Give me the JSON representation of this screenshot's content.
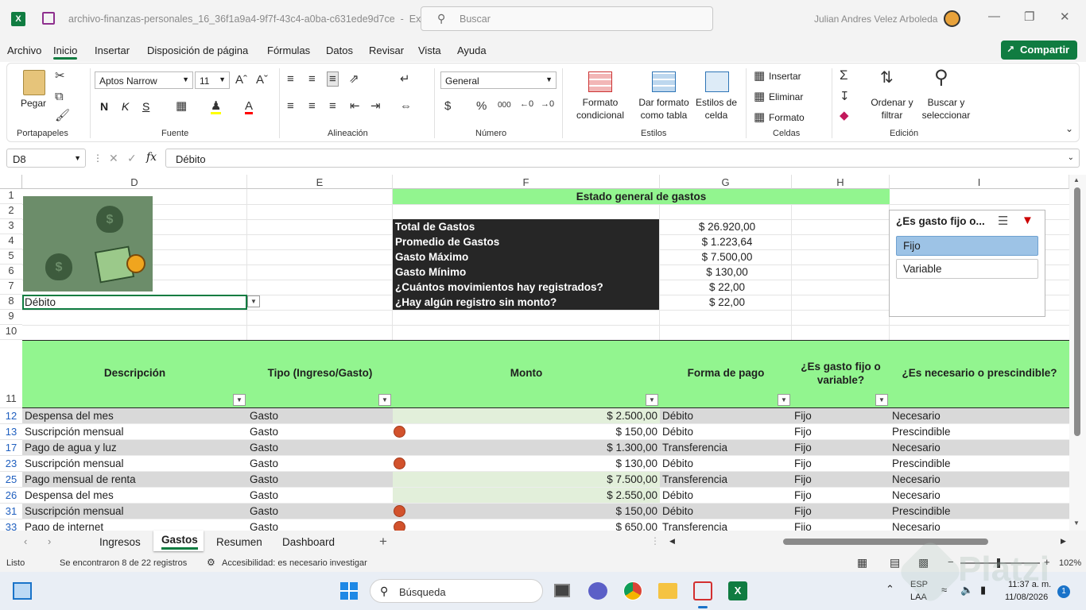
{
  "titlebar": {
    "filename": "archivo-finanzas-personales_16_36f1a9a4-9f7f-43c4-a0ba-c631ede9d7ce",
    "app": "Excel",
    "search_placeholder": "Buscar",
    "user": "Julian Andres Velez Arboleda"
  },
  "menu": {
    "items": [
      "Archivo",
      "Inicio",
      "Insertar",
      "Disposición de página",
      "Fórmulas",
      "Datos",
      "Revisar",
      "Vista",
      "Ayuda"
    ],
    "active": "Inicio",
    "share": "Compartir"
  },
  "ribbon": {
    "paste": "Pegar",
    "font_name": "Aptos Narrow",
    "font_size": "11",
    "bold": "N",
    "italic": "K",
    "underline": "S",
    "number_format": "General",
    "cond_format": [
      "Formato",
      "condicional"
    ],
    "format_table": [
      "Dar formato",
      "como tabla"
    ],
    "cell_styles": [
      "Estilos de",
      "celda"
    ],
    "insert": "Insertar",
    "delete": "Eliminar",
    "format": "Formato",
    "sort_filter": [
      "Ordenar y",
      "filtrar"
    ],
    "find_select": [
      "Buscar y",
      "seleccionar"
    ],
    "groups": [
      "Portapapeles",
      "Fuente",
      "Alineación",
      "Número",
      "Estilos",
      "Celdas",
      "Edición"
    ]
  },
  "formula_bar": {
    "namebox": "D8",
    "fx": "fx",
    "content": "Débito"
  },
  "columns": [
    "D",
    "E",
    "F",
    "G",
    "H",
    "I"
  ],
  "rows": [
    "1",
    "2",
    "3",
    "4",
    "5",
    "6",
    "7",
    "8",
    "9",
    "10",
    "11",
    "12",
    "13",
    "17",
    "23",
    "25",
    "26",
    "31",
    "33"
  ],
  "summary": {
    "header": "Estado general de gastos",
    "labels": [
      "Total de Gastos",
      "Promedio de Gastos",
      "Gasto Máximo",
      "Gasto Mínimo",
      "¿Cuántos movimientos hay registrados?",
      "¿Hay algún registro sin monto?"
    ],
    "values": [
      "$ 26.920,00",
      "$ 1.223,64",
      "$ 7.500,00",
      "$ 130,00",
      "$ 22,00",
      "$ 22,00"
    ]
  },
  "d8_value": "Débito",
  "table": {
    "headers": [
      "Descripción",
      "Tipo (Ingreso/Gasto)",
      "Monto",
      "Forma de pago",
      "¿Es gasto fijo o variable?",
      "¿Es necesario o prescindible?"
    ],
    "rows": [
      {
        "row": "12",
        "desc": "Despensa del mes",
        "tipo": "Gasto",
        "monto": "$ 2.500,00",
        "forma": "Débito",
        "fijo": "Fijo",
        "nec": "Necesario",
        "dot": false
      },
      {
        "row": "13",
        "desc": "Suscripción mensual",
        "tipo": "Gasto",
        "monto": "$ 150,00",
        "forma": "Débito",
        "fijo": "Fijo",
        "nec": "Prescindible",
        "dot": true
      },
      {
        "row": "17",
        "desc": "Pago de agua y luz",
        "tipo": "Gasto",
        "monto": "$ 1.300,00",
        "forma": "Transferencia",
        "fijo": "Fijo",
        "nec": "Necesario",
        "dot": false
      },
      {
        "row": "23",
        "desc": "Suscripción mensual",
        "tipo": "Gasto",
        "monto": "$ 130,00",
        "forma": "Débito",
        "fijo": "Fijo",
        "nec": "Prescindible",
        "dot": true
      },
      {
        "row": "25",
        "desc": "Pago mensual de renta",
        "tipo": "Gasto",
        "monto": "$ 7.500,00",
        "forma": "Transferencia",
        "fijo": "Fijo",
        "nec": "Necesario",
        "dot": false
      },
      {
        "row": "26",
        "desc": "Despensa del mes",
        "tipo": "Gasto",
        "monto": "$ 2.550,00",
        "forma": "Débito",
        "fijo": "Fijo",
        "nec": "Necesario",
        "dot": false
      },
      {
        "row": "31",
        "desc": "Suscripción mensual",
        "tipo": "Gasto",
        "monto": "$ 150,00",
        "forma": "Débito",
        "fijo": "Fijo",
        "nec": "Prescindible",
        "dot": true
      },
      {
        "row": "33",
        "desc": "Pago de internet",
        "tipo": "Gasto",
        "monto": "$ 650,00",
        "forma": "Transferencia",
        "fijo": "Fijo",
        "nec": "Necesario",
        "dot": true
      }
    ]
  },
  "slicer": {
    "title": "¿Es gasto fijo o...",
    "items": [
      "Fijo",
      "Variable"
    ],
    "selected": "Fijo"
  },
  "sheets": {
    "tabs": [
      "Ingresos",
      "Gastos",
      "Resumen",
      "Dashboard"
    ],
    "active": "Gastos"
  },
  "status": {
    "ready": "Listo",
    "records": "Se encontraron 8 de 22 registros",
    "accessibility": "Accesibilidad: es necesario investigar",
    "zoom": "102%"
  },
  "taskbar": {
    "search": "Búsqueda",
    "lang1": "ESP",
    "lang2": "LAA",
    "time": "11:37 a. m.",
    "date": "11/08/2026",
    "notif": "1"
  },
  "watermark": "Platzi",
  "colors": {
    "excel_green": "#107c41",
    "header_green": "#92f58f",
    "dark_cell": "#262626",
    "row_stripe": "#d9d9d9",
    "light_green": "#e2efda",
    "slicer_selected": "#9dc3e6",
    "dot_red": "#d2522c"
  }
}
